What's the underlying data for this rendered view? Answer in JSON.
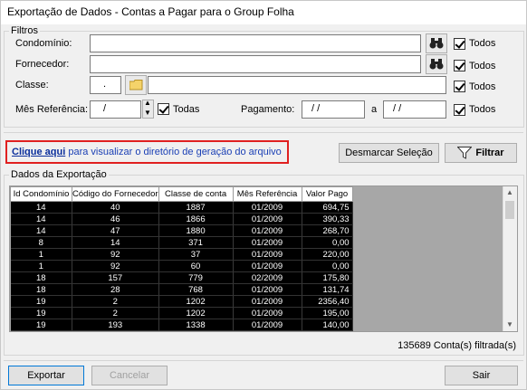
{
  "window": {
    "title": "Exportação de Dados - Contas a Pagar para o Group Folha"
  },
  "filters": {
    "group_label": "Filtros",
    "condominio_label": "Condomínio:",
    "fornecedor_label": "Fornecedor:",
    "classe_label": "Classe:",
    "classe_code": ".",
    "mes_label": "Mês Referência:",
    "mes_value": "/",
    "pagamento_label": "Pagamento:",
    "pagamento_from": "/  /",
    "pagamento_a": "a",
    "pagamento_to": "/  /",
    "todos": "Todos",
    "todas": "Todas"
  },
  "actions": {
    "link_bold": "Clique aqui",
    "link_rest": " para visualizar o diretório de geração do arquivo",
    "desmarcar": "Desmarcar Seleção",
    "filtrar": "Filtrar"
  },
  "export": {
    "group_label": "Dados da Exportação",
    "columns": [
      "Id Condomínio",
      "Código do Fornecedor",
      "Classe de conta",
      "Mês Referência",
      "Valor Pago"
    ],
    "rows": [
      [
        "14",
        "40",
        "1887",
        "01/2009",
        "694,75"
      ],
      [
        "14",
        "46",
        "1866",
        "01/2009",
        "390,33"
      ],
      [
        "14",
        "47",
        "1880",
        "01/2009",
        "268,70"
      ],
      [
        "8",
        "14",
        "371",
        "01/2009",
        "0,00"
      ],
      [
        "1",
        "92",
        "37",
        "01/2009",
        "220,00"
      ],
      [
        "1",
        "92",
        "60",
        "01/2009",
        "0,00"
      ],
      [
        "18",
        "157",
        "779",
        "02/2009",
        "175,80"
      ],
      [
        "18",
        "28",
        "768",
        "01/2009",
        "131,74"
      ],
      [
        "19",
        "2",
        "1202",
        "01/2009",
        "2356,40"
      ],
      [
        "19",
        "2",
        "1202",
        "01/2009",
        "195,00"
      ],
      [
        "19",
        "193",
        "1338",
        "01/2009",
        "140,00"
      ]
    ],
    "count_text": "135689 Conta(s) filtrada(s)"
  },
  "footer": {
    "exportar": "Exportar",
    "cancelar": "Cancelar",
    "sair": "Sair"
  }
}
